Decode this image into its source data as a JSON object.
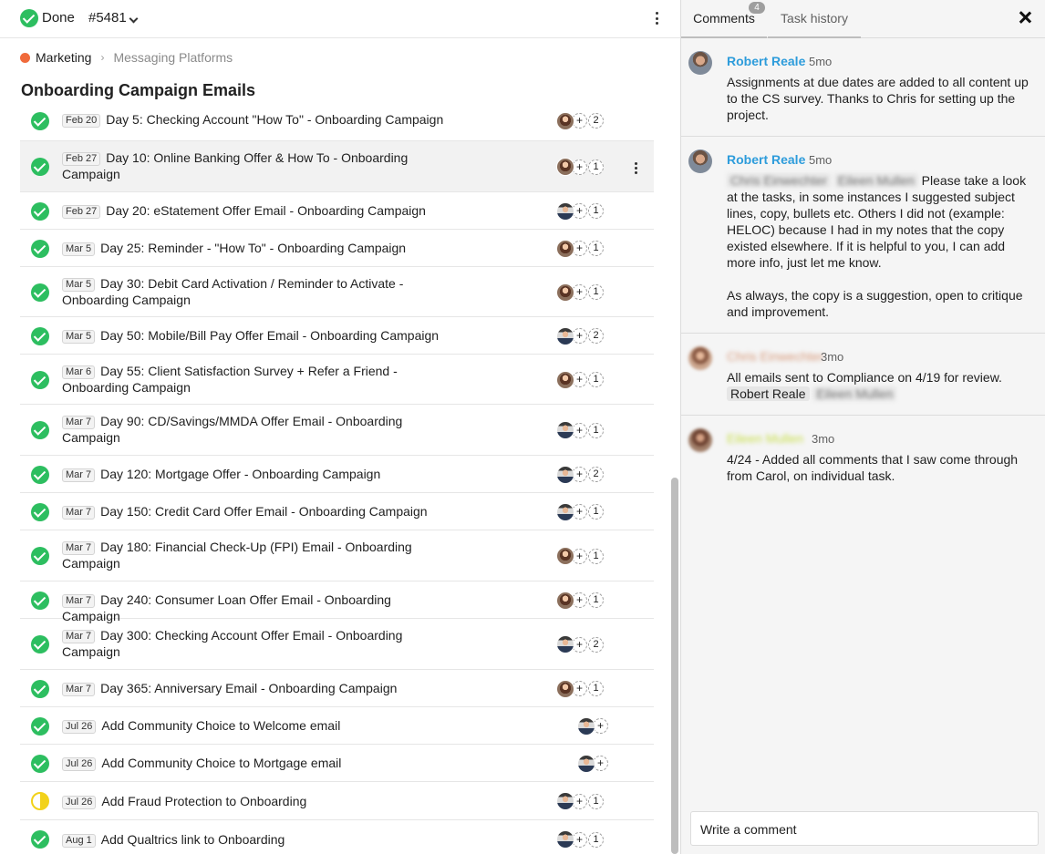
{
  "header": {
    "status_label": "Done",
    "task_id": "#5481"
  },
  "breadcrumb": {
    "parent": "Marketing",
    "separator": "›",
    "current": "Messaging Platforms",
    "dot_color": "#f06a3b"
  },
  "list": {
    "title": "Onboarding Campaign Emails",
    "tasks": [
      {
        "date": "Feb 20",
        "title": "Day 5: Checking Account \"How To\" - Onboarding Campaign",
        "status": "done",
        "avatar": "female",
        "count": "2"
      },
      {
        "date": "Feb 27",
        "title": "Day 10: Online Banking Offer & How To - Onboarding Campaign",
        "status": "done",
        "avatar": "female",
        "count": "1"
      },
      {
        "date": "Feb 27",
        "title": "Day 20: eStatement Offer Email - Onboarding Campaign",
        "status": "done",
        "avatar": "male",
        "count": "1"
      },
      {
        "date": "Mar 5",
        "title": "Day 25: Reminder - \"How To\" - Onboarding Campaign",
        "status": "done",
        "avatar": "female",
        "count": "1"
      },
      {
        "date": "Mar 5",
        "title": "Day 30: Debit Card Activation / Reminder to Activate - Onboarding Campaign",
        "status": "done",
        "avatar": "female",
        "count": "1"
      },
      {
        "date": "Mar 5",
        "title": "Day 50: Mobile/Bill Pay Offer Email - Onboarding Campaign",
        "status": "done",
        "avatar": "male",
        "count": "2"
      },
      {
        "date": "Mar 6",
        "title": "Day 55: Client Satisfaction Survey + Refer a Friend - Onboarding Campaign",
        "status": "done",
        "avatar": "female",
        "count": "1"
      },
      {
        "date": "Mar 7",
        "title": "Day 90: CD/Savings/MMDA Offer Email - Onboarding Campaign",
        "status": "done",
        "avatar": "male",
        "count": "1"
      },
      {
        "date": "Mar 7",
        "title": "Day 120: Mortgage Offer - Onboarding Campaign",
        "status": "done",
        "avatar": "male",
        "count": "2"
      },
      {
        "date": "Mar 7",
        "title": "Day 150: Credit Card Offer Email - Onboarding Campaign",
        "status": "done",
        "avatar": "male",
        "count": "1"
      },
      {
        "date": "Mar 7",
        "title": "Day 180: Financial Check-Up (FPI) Email - Onboarding Campaign",
        "status": "done",
        "avatar": "female",
        "count": "1"
      },
      {
        "date": "Mar 7",
        "title": "Day 240: Consumer Loan Offer Email - Onboarding Campaign",
        "status": "done",
        "avatar": "female",
        "count": "1"
      },
      {
        "date": "Mar 7",
        "title": "Day 300: Checking Account Offer Email - Onboarding Campaign",
        "status": "done",
        "avatar": "male",
        "count": "2"
      },
      {
        "date": "Mar 7",
        "title": "Day 365: Anniversary Email - Onboarding Campaign",
        "status": "done",
        "avatar": "female",
        "count": "1"
      },
      {
        "date": "Jul 26",
        "title": "Add Community Choice to Welcome email",
        "status": "done",
        "avatar": "male",
        "count": ""
      },
      {
        "date": "Jul 26",
        "title": "Add Community Choice to Mortgage email",
        "status": "done",
        "avatar": "male",
        "count": ""
      },
      {
        "date": "Jul 26",
        "title": "Add Fraud Protection to Onboarding",
        "status": "in-progress",
        "avatar": "male",
        "count": "1"
      },
      {
        "date": "Aug 1",
        "title": "Add Qualtrics link to Onboarding",
        "status": "done",
        "avatar": "male",
        "count": "1"
      }
    ]
  },
  "panel": {
    "tabs": {
      "comments_label": "Comments",
      "comments_count": "4",
      "history_label": "Task history"
    },
    "comments": [
      {
        "author": "Robert Reale",
        "time": "5mo",
        "paragraphs": [
          "Assignments at due dates are added to all content up to the CS survey. Thanks to Chris for setting up the project."
        ]
      },
      {
        "author": "Robert Reale",
        "time": "5mo",
        "mention_1": "Chris Einwechter",
        "mention_2": "Eileen Mullen",
        "paragraphs": [
          "Please take a look at the tasks, in some instances I suggested subject lines, copy, bullets etc. Others I did not (example: HELOC) because I had in my notes that the copy existed elsewhere. If it is helpful to you, I can add more info, just let me know.",
          "As always, the copy is a suggestion, open to critique and improvement."
        ]
      },
      {
        "author": "Chris Einwechter",
        "time": "3mo",
        "text": "All emails sent to Compliance on 4/19 for review.",
        "mention_1": "Robert Reale",
        "mention_2": "Eileen Mullen"
      },
      {
        "author": "Eileen Mullen",
        "time": "3mo",
        "paragraphs": [
          "4/24 - Added all comments that I saw come through from Carol, on individual task."
        ]
      }
    ],
    "comment_input_placeholder": "Write a comment"
  },
  "colors": {
    "done_green": "#2dbe60",
    "in_progress_yellow": "#f2d21a",
    "author_blue": "#2d9cdb"
  }
}
